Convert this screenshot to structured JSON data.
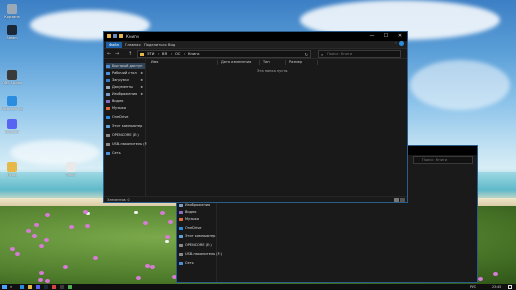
{
  "desktop_icons": [
    {
      "label": "Корзина",
      "color": "#9aa9b8"
    },
    {
      "label": "Steam",
      "color": "#1b2838"
    },
    {
      "label": "OBS Studio",
      "color": "#3a3a3a"
    },
    {
      "label": "Microsoft Edge",
      "color": "#2a8de0"
    },
    {
      "label": "Discord",
      "color": "#5865f2"
    },
    {
      "label": "Игры",
      "color": "#e6b84a"
    },
    {
      "label": "Текст",
      "color": "#e9e9e9"
    }
  ],
  "back_window": {
    "search_placeholder": "Поиск: Книги",
    "nav": [
      {
        "label": "Изображения",
        "color": "#7a9cc6"
      },
      {
        "label": "Видео",
        "color": "#8a6cc6"
      },
      {
        "label": "Музыка",
        "color": "#e06c3c"
      },
      {
        "label": "OneDrive",
        "color": "#2a8de0"
      },
      {
        "label": "Этот компьютер",
        "color": "#5ea0d8"
      },
      {
        "label": "OPENCORE (E:)",
        "color": "#8a8a8a"
      },
      {
        "label": "USB-накопитель (F:)",
        "color": "#8a8a8a"
      },
      {
        "label": "Сеть",
        "color": "#4a90d9"
      }
    ]
  },
  "window": {
    "title": "Книги",
    "controls": {
      "minimize": "—",
      "maximize": "☐",
      "close": "✕"
    },
    "ribbon_tabs": [
      "Файл",
      "Главная",
      "Поделиться",
      "Вид"
    ],
    "address": {
      "back": "←",
      "forward": "→",
      "up": "↑",
      "path": [
        "ЭТИ",
        "ВЯ",
        "ОС",
        "Книги"
      ]
    },
    "search_placeholder": "Поиск: Книги",
    "nav": [
      {
        "label": "Быстрый доступ",
        "color": "#4a90d9",
        "pinned": false
      },
      {
        "label": "Рабочий стол",
        "color": "#4a90d9",
        "pinned": true
      },
      {
        "label": "Загрузки",
        "color": "#3a7cc8",
        "pinned": true
      },
      {
        "label": "Документы",
        "color": "#9aa9b8",
        "pinned": true
      },
      {
        "label": "Изображения",
        "color": "#7a9cc6",
        "pinned": true
      },
      {
        "label": "Видео",
        "color": "#8a6cc6",
        "pinned": false
      },
      {
        "label": "Музыка",
        "color": "#e06c3c",
        "pinned": false
      },
      {
        "label": "OneDrive",
        "color": "#2a8de0",
        "pinned": false
      },
      {
        "label": "Этот компьютер",
        "color": "#5ea0d8",
        "pinned": false
      },
      {
        "label": "OPENCORE (E:)",
        "color": "#8a8a8a",
        "pinned": false
      },
      {
        "label": "USB-накопитель (F:)",
        "color": "#8a8a8a",
        "pinned": false
      },
      {
        "label": "Сеть",
        "color": "#4a90d9",
        "pinned": false
      }
    ],
    "columns": [
      "Имя",
      "Дата изменения",
      "Тип",
      "Размер"
    ],
    "empty_text": "Эта папка пуста.",
    "status": "Элементов: 0"
  },
  "taskbar": {
    "icons": [
      "#2a8de0",
      "#e6b84a",
      "#5865f2",
      "#1b2838",
      "#d64545",
      "#3a3a3a",
      "#4caf50"
    ],
    "lang": "РУС",
    "time": "23:45"
  }
}
